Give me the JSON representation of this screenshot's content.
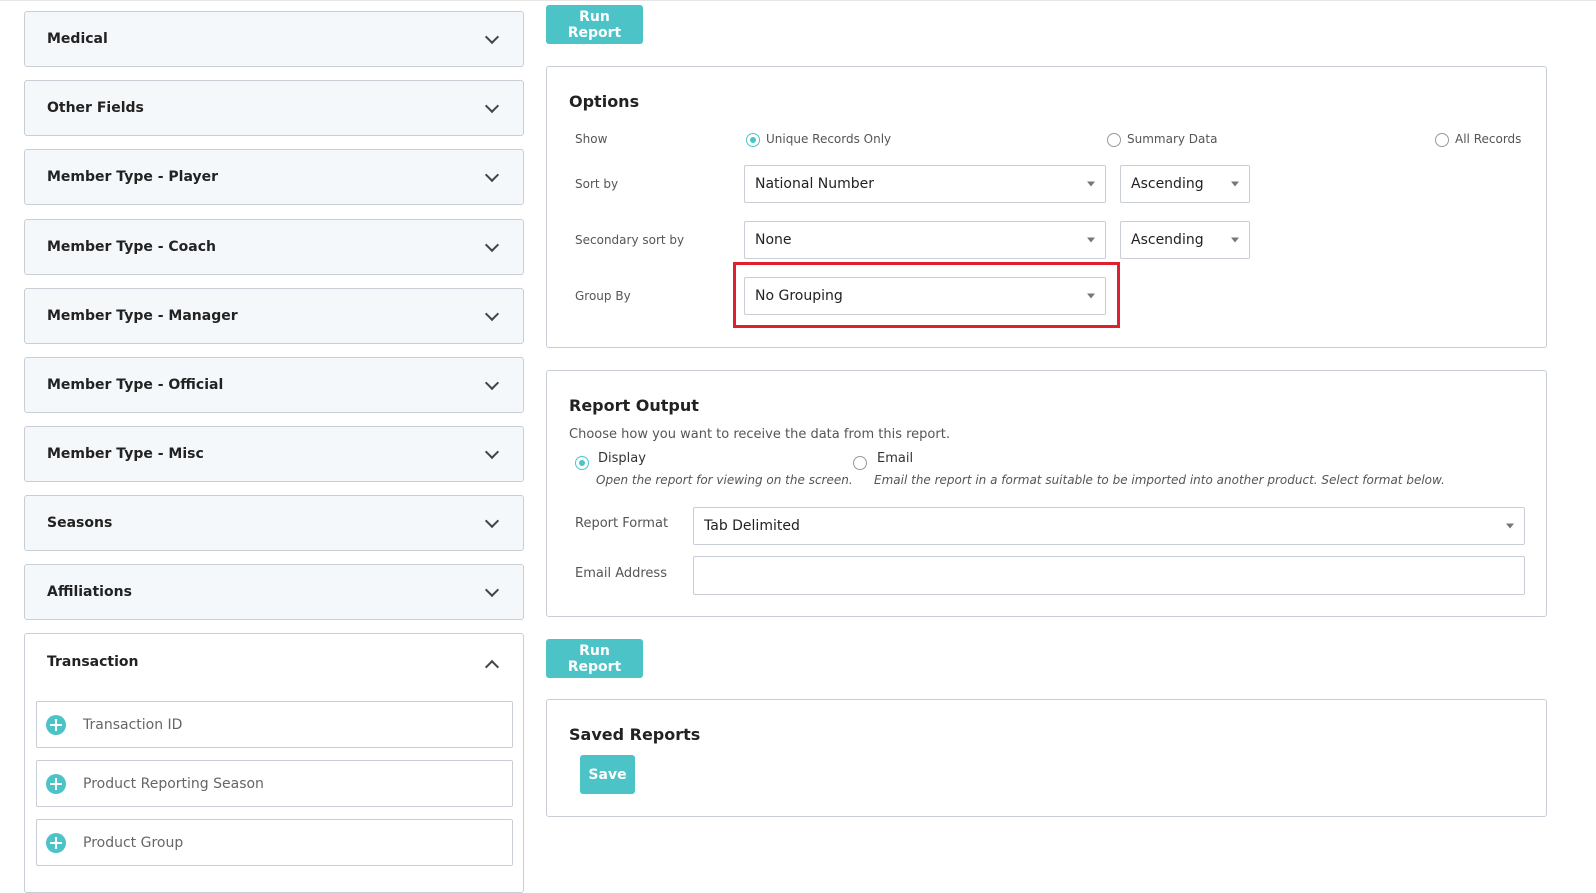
{
  "sidebar": {
    "sections": [
      {
        "label": "Medical"
      },
      {
        "label": "Other Fields"
      },
      {
        "label": "Member Type - Player"
      },
      {
        "label": "Member Type - Coach"
      },
      {
        "label": "Member Type - Manager"
      },
      {
        "label": "Member Type - Official"
      },
      {
        "label": "Member Type - Misc"
      },
      {
        "label": "Seasons"
      },
      {
        "label": "Affiliations"
      }
    ],
    "transaction": {
      "label": "Transaction",
      "fields": [
        {
          "label": "Transaction ID"
        },
        {
          "label": "Product Reporting Season"
        },
        {
          "label": "Product Group"
        }
      ]
    }
  },
  "run_report_label": "Run Report",
  "options": {
    "title": "Options",
    "show_label": "Show",
    "show_options": [
      {
        "label": "Unique Records Only",
        "selected": true
      },
      {
        "label": "Summary Data",
        "selected": false
      },
      {
        "label": "All Records",
        "selected": false
      }
    ],
    "sort_by_label": "Sort by",
    "sort_by_value": "National Number",
    "sort_dir_value": "Ascending",
    "secondary_sort_label": "Secondary sort by",
    "secondary_sort_value": "None",
    "secondary_dir_value": "Ascending",
    "group_by_label": "Group By",
    "group_by_value": "No Grouping"
  },
  "output": {
    "title": "Report Output",
    "intro": "Choose how you want to receive the data from this report.",
    "display_label": "Display",
    "display_desc": "Open the report for viewing on the screen.",
    "email_label": "Email",
    "email_desc": "Email the report in a format suitable to be imported into another product. Select format below.",
    "selected": "Display",
    "format_label": "Report Format",
    "format_value": "Tab Delimited",
    "email_address_label": "Email Address",
    "email_address_value": ""
  },
  "saved": {
    "title": "Saved Reports",
    "save_label": "Save"
  },
  "colors": {
    "accent": "#4cc4c7",
    "highlight": "#e0202e",
    "panel_border": "#c9ced6"
  }
}
